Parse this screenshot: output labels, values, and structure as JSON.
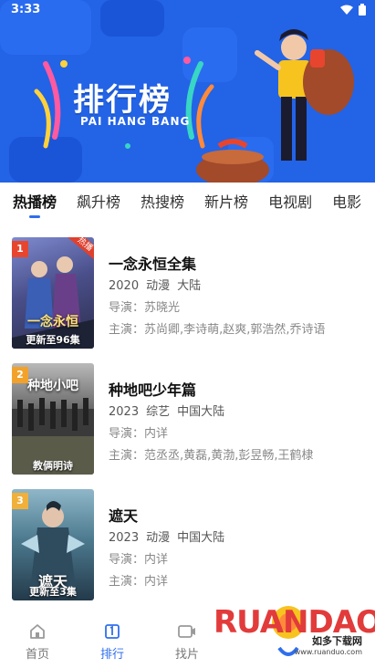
{
  "status_bar": {
    "time": "3:33"
  },
  "banner": {
    "title": "排行榜",
    "subtitle": "PAI HANG BANG"
  },
  "tabs": [
    {
      "label": "热播榜",
      "active": true
    },
    {
      "label": "飙升榜",
      "active": false
    },
    {
      "label": "热搜榜",
      "active": false
    },
    {
      "label": "新片榜",
      "active": false
    },
    {
      "label": "电视剧",
      "active": false
    },
    {
      "label": "电影",
      "active": false
    }
  ],
  "items": [
    {
      "rank": "1",
      "rank_color": "#e8452e",
      "hot_tag": "热播",
      "poster_caption": "更新至96集",
      "poster_art_text": "一念永恒",
      "title": "一念永恒全集",
      "year": "2020",
      "genre": "动漫",
      "region": "大陆",
      "director": "导演：苏晓光",
      "cast": "主演：苏尚卿,李诗萌,赵爽,郭浩然,乔诗语"
    },
    {
      "rank": "2",
      "rank_color": "#f2a22a",
      "poster_caption": "教俩明诗",
      "poster_art_text": "种地小吧",
      "title": "种地吧少年篇",
      "year": "2023",
      "genre": "综艺",
      "region": "中国大陆",
      "director": "导演：内详",
      "cast": "主演：范丞丞,黄磊,黄渤,彭昱畅,王鹤棣"
    },
    {
      "rank": "3",
      "rank_color": "#f0b03a",
      "poster_caption": "更新至3集",
      "poster_art_text": "遮天",
      "title": "遮天",
      "year": "2023",
      "genre": "动漫",
      "region": "中国大陆",
      "director": "导演：内详",
      "cast": "主演：内详"
    }
  ],
  "bottom_nav": [
    {
      "label": "首页",
      "icon": "home-icon",
      "active": false
    },
    {
      "label": "排行",
      "icon": "ranking-icon",
      "active": true
    },
    {
      "label": "找片",
      "icon": "video-icon",
      "active": false
    }
  ],
  "watermark": {
    "brand": "RUANDAO",
    "sub": "如多下载网",
    "url": "www.ruanduo.com"
  },
  "colors": {
    "accent": "#2f6fed",
    "banner_bg": "#1f5fe0"
  }
}
